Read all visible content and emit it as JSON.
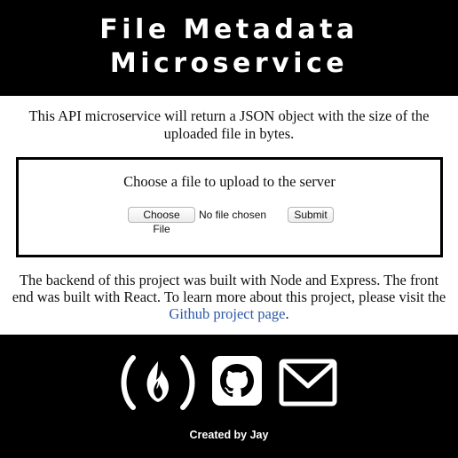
{
  "header": {
    "title_line1": "File Metadata",
    "title_line2": "Microservice"
  },
  "intro": {
    "text": "This API microservice will return a JSON object with the size of the uploaded file in bytes."
  },
  "upload_form": {
    "prompt": "Choose a file to upload to the server",
    "choose_file_label": "Choose File",
    "file_status": "No file chosen",
    "submit_label": "Submit"
  },
  "about": {
    "text_before_link": "The backend of this project was built with Node and Express. The front end was built with React. To learn more about this project, please visit the ",
    "link_text": "Github project page",
    "text_after_link": "."
  },
  "footer": {
    "icons": [
      "freecodecamp-icon",
      "github-icon",
      "mail-icon"
    ],
    "credit": "Created by Jay"
  },
  "colors": {
    "header_bg": "#000000",
    "footer_bg": "#000000",
    "link": "#2b58a8",
    "icon": "#ffffff"
  }
}
